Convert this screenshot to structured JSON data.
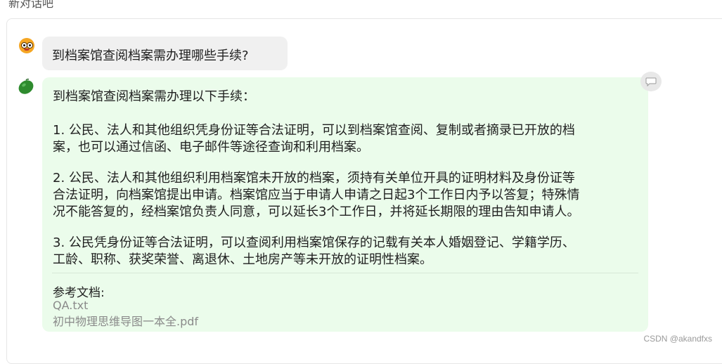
{
  "top_cut_text": "新对话吧",
  "user": {
    "avatar": "emoji-face-avatar",
    "message": "到档案馆查阅档案需办理哪些手续?"
  },
  "bot": {
    "avatar": "green-bean-avatar",
    "lines": [
      "到档案馆查阅档案需办理以下手续：",
      "1. 公民、法人和其他组织凭身份证等合法证明，可以到档案馆查阅、复制或者摘录已开放的档",
      "案，也可以通过信函、电子邮件等途径查询和利用档案。",
      "2. 公民、法人和其他组织利用档案馆未开放的档案，须持有关单位开具的证明材料及身份证等",
      "合法证明，向档案馆提出申请。档案馆应当于申请人申请之日起3个工作日内予以答复；特殊情",
      "况不能答复的，经档案馆负责人同意，可以延长3个工作日，并将延长期限的理由告知申请人。",
      "3. 公民凭身份证等合法证明，可以查阅利用档案馆保存的记载有关本人婚姻登记、学籍学历、",
      "工龄、职称、获奖荣誉、离退休、土地房产等未开放的证明性档案。"
    ],
    "references_title": "参考文档:",
    "references": [
      "QA.txt",
      "初中物理思维导图一本全.pdf"
    ]
  },
  "watermark": "CSDN @akandfxs",
  "colors": {
    "bot_bubble": "#ebfceb",
    "user_bubble": "#f0f0f0",
    "reference_text": "#8a8a8a"
  }
}
